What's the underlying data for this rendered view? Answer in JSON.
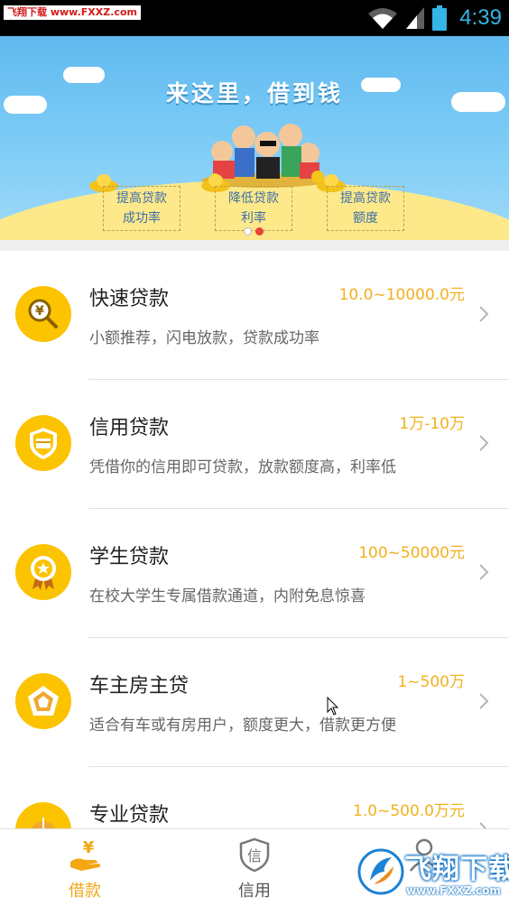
{
  "status_bar": {
    "watermark": "飞翔下载 www.FXXZ.com",
    "time": "4:39"
  },
  "banner": {
    "title": "来这里，借到钱",
    "boxes": [
      {
        "line1": "提高贷款",
        "line2": "成功率"
      },
      {
        "line1": "降低贷款",
        "line2": "利率"
      },
      {
        "line1": "提高贷款",
        "line2": "额度"
      }
    ],
    "carousel_active_index": 1,
    "carousel_count": 2
  },
  "loans": [
    {
      "title": "快速贷款",
      "range": "10.0~10000.0元",
      "desc": "小额推荐，闪电放款，贷款成功率",
      "icon": "magnifier-yen-icon"
    },
    {
      "title": "信用贷款",
      "range": "1万-10万",
      "desc": "凭借你的信用即可贷款，放款额度高，利率低",
      "icon": "shield-card-icon"
    },
    {
      "title": "学生贷款",
      "range": "100~50000元",
      "desc": "在校大学生专属借款通道，内附免息惊喜",
      "icon": "star-badge-icon"
    },
    {
      "title": "车主房主贷",
      "range": "1~500万",
      "desc": "适合有车或有房用户，额度更大，借款更方便",
      "icon": "pentagon-icon"
    },
    {
      "title": "专业贷款",
      "range": "1.0~500.0万元",
      "desc": "",
      "icon": "umbrella-icon"
    }
  ],
  "bottom_nav": {
    "tabs": [
      {
        "label": "借款",
        "icon": "hand-yen-icon",
        "active": true
      },
      {
        "label": "信用",
        "icon": "shield-xin-icon",
        "active": false
      },
      {
        "label": "",
        "icon": "person-icon",
        "active": false
      }
    ],
    "watermark_text": "飞翔下载",
    "watermark_url": "www.FXXZ.com"
  },
  "colors": {
    "accent": "#fcc300",
    "range_text": "#f2b01e",
    "active_tab": "#f2a713",
    "status_clock": "#33b5e5"
  }
}
